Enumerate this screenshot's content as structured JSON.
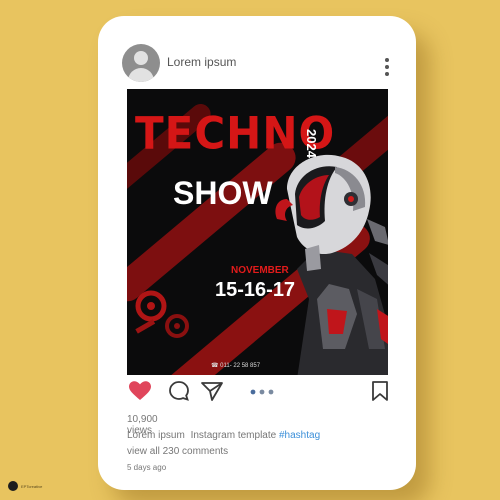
{
  "post": {
    "username": "Lorem ipsum",
    "poster": {
      "title": "TECHNO",
      "year": "2024",
      "subtitle": "SHOW",
      "month": "NOVEMBER",
      "dates": "15-16-17",
      "phone": "☎ 011- 22 58 857"
    },
    "views": "10,900 views",
    "caption_user": "Lorem ipsum",
    "caption_text": "Instagram template",
    "hashtag": "#hashtag",
    "comments_link": "view all 230 comments",
    "time_ago": "5 days ago",
    "liked": true
  },
  "icons": {
    "menu": "more-vertical-icon",
    "like": "heart-icon",
    "comment": "comment-icon",
    "share": "send-icon",
    "carousel": "carousel-dots-icon",
    "save": "bookmark-icon"
  },
  "colors": {
    "background": "#e8c45f",
    "like": "#e0455b",
    "hashtag": "#3b8fd9",
    "poster_red": "#d51616"
  },
  "watermark": "EPTcreative"
}
